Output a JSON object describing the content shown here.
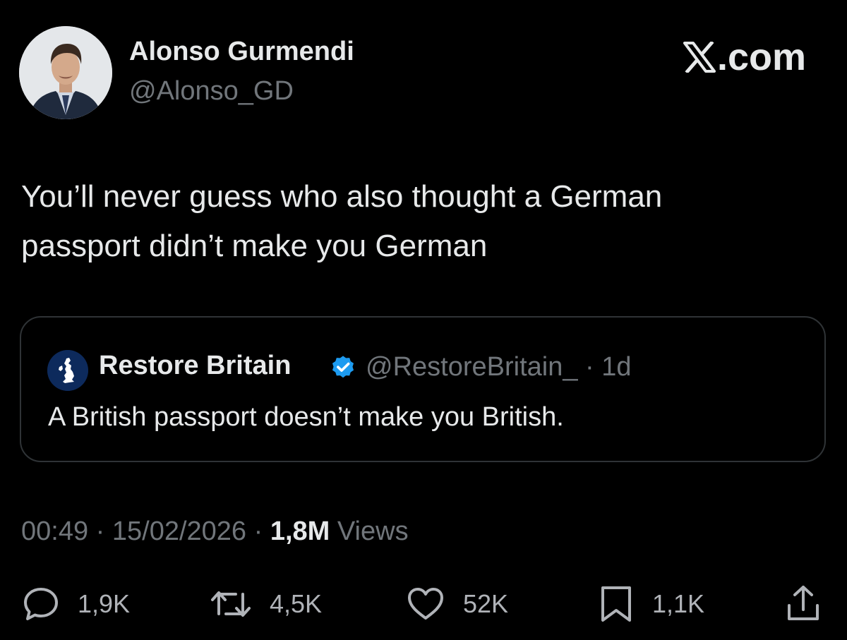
{
  "author": {
    "name": "Alonso Gurmendi",
    "handle": "@Alonso_GD"
  },
  "brand": {
    "label": ".com"
  },
  "tweet": {
    "text_line1": "You’ll never guess who also thought a German",
    "text_line2": "passport didn’t make you German"
  },
  "quoted_tweet": {
    "name": "Restore Britain",
    "handle_and_time": "@RestoreBritain_ · 1d",
    "text": "A British passport doesn’t make you British."
  },
  "meta": {
    "time": "00:49",
    "date": "15/02/2026",
    "views_count": "1,8M",
    "views_label": "Views",
    "separator": "·"
  },
  "actions": {
    "replies": "1,9K",
    "reposts": "4,5K",
    "likes": "52K",
    "bookmarks": "1,1K"
  },
  "colors": {
    "background": "#000000",
    "text_primary": "#e7e9ea",
    "text_secondary": "#71767b",
    "border": "#2f3336",
    "verified_badge": "#1d9bf0"
  },
  "icons": {
    "reply": "speech-bubble-icon",
    "repost": "repost-arrows-icon",
    "like": "heart-icon",
    "bookmark": "bookmark-icon",
    "share": "share-upload-icon",
    "verified": "verified-badge-icon",
    "brand": "x-logo-icon"
  }
}
